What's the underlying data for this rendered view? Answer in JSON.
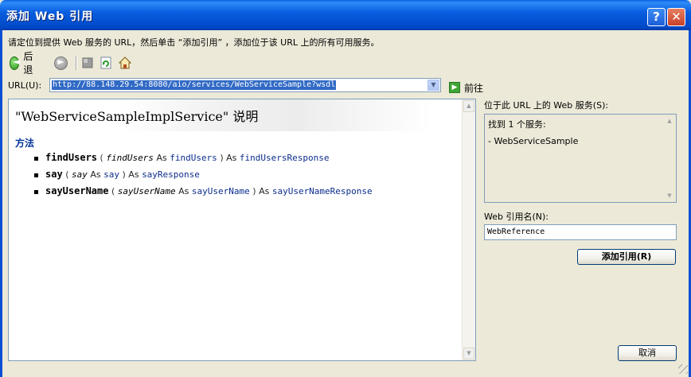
{
  "window": {
    "title": "添加 Web 引用",
    "help_glyph": "?",
    "close_glyph": "✕"
  },
  "instruction": "请定位到提供 Web 服务的 URL，然后单击 “添加引用” ，添加位于该 URL 上的所有可用服务。",
  "toolbar": {
    "back_label": "后退"
  },
  "url": {
    "label": "URL(U):",
    "value": "http://88.148.29.54:8080/aio/services/WebServiceSample?wsdl",
    "go_label": "前往"
  },
  "browser": {
    "service_title": "\"WebServiceSampleImplService\" 说明",
    "methods_heading": "方法",
    "methods": [
      {
        "name": "findUsers",
        "param": "findUsers",
        "param_type": "findUsers",
        "return_type": "findUsersResponse"
      },
      {
        "name": "say",
        "param": "say",
        "param_type": "say",
        "return_type": "sayResponse"
      },
      {
        "name": "sayUserName",
        "param": "sayUserName",
        "param_type": "sayUserName",
        "return_type": "sayUserNameResponse"
      }
    ],
    "open_paren": "(",
    "close_paren": ")",
    "as_keyword": "As"
  },
  "services": {
    "label": "位于此 URL 上的 Web 服务(S):",
    "found_text": "找到 1 个服务:",
    "items": [
      "- WebServiceSample"
    ]
  },
  "reference": {
    "label": "Web 引用名(N):",
    "value": "WebReference",
    "add_button": "添加引用(R)"
  },
  "cancel_button": "取消",
  "colors": {
    "titlebar": "#0a5ee0",
    "selection": "#316ac5",
    "type_link": "#0b2d8c",
    "methods_heading": "#003399"
  }
}
